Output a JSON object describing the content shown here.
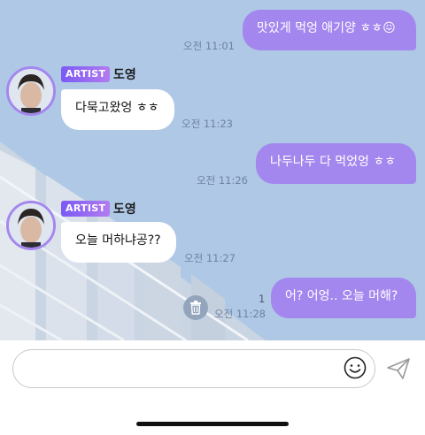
{
  "messages": [
    {
      "type": "out",
      "text": "맛있게 먹엉 애기양 ㅎㅎ😖",
      "time": "오전 11:01"
    },
    {
      "type": "in",
      "badge": "ARTIST",
      "sender": "도영",
      "text": "다묵고왔엉 ㅎㅎ",
      "time": "오전 11:23"
    },
    {
      "type": "out",
      "text": "나두나두 다 먹었엉 ㅎㅎ",
      "time": "오전 11:26"
    },
    {
      "type": "in",
      "badge": "ARTIST",
      "sender": "도영",
      "text": "오늘 머하냐공??",
      "time": "오전 11:27"
    },
    {
      "type": "out",
      "text": "어? 어엉.. 오늘 머해?",
      "time": "오전 11:28",
      "unread_count": "1"
    }
  ],
  "input": {
    "placeholder": "",
    "value": ""
  },
  "icons": {
    "emoji": "smiley-icon",
    "send": "paper-plane-icon",
    "delete": "trash-icon"
  },
  "colors": {
    "accent": "#a487ee",
    "background": "#aec8e6",
    "incoming": "#ffffff"
  }
}
